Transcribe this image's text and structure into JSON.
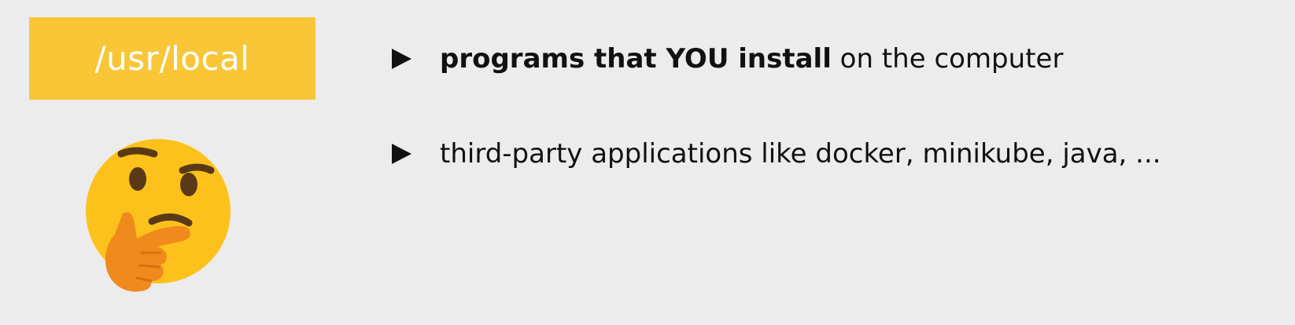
{
  "slide": {
    "label": "/usr/local",
    "label_color": "#f8c637",
    "emoji": "thinking-face",
    "bullets": [
      {
        "bold": "programs that YOU install",
        "rest": " on the computer"
      },
      {
        "bold": "",
        "rest": "third-party applications like docker, minikube, java, ..."
      }
    ]
  }
}
